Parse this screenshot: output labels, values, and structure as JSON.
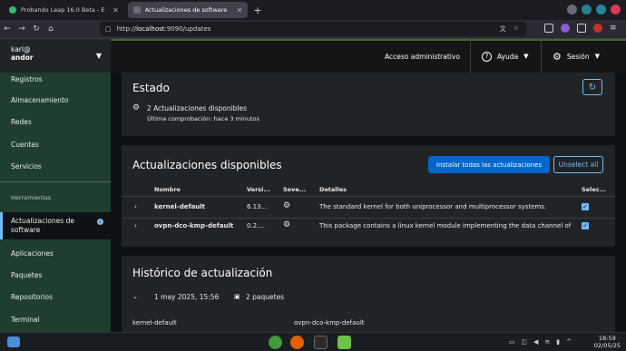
{
  "browser": {
    "tabs": [
      {
        "title": "Probando Leap 16.0 Beta - E",
        "active": false
      },
      {
        "title": "Actualizaciones de software",
        "active": true
      }
    ],
    "url_prefix": "http://",
    "url_host": "localhost",
    "url_rest": ":9090/updates"
  },
  "header": {
    "user": "karl@",
    "host": "andor",
    "admin_access": "Acceso administrativo",
    "help": "Ayuda",
    "session": "Sesión"
  },
  "sidebar": {
    "items_top": [
      "Registros",
      "Almacenamiento",
      "Redes",
      "Cuentas",
      "Servicios"
    ],
    "section": "Herramientas",
    "items_tools": [
      "Actualizaciones de software",
      "Aplicaciones",
      "Paquetes",
      "Repositorios",
      "Terminal"
    ]
  },
  "status_card": {
    "title": "Estado",
    "message": "2 Actualizaciones disponibles",
    "last_check": "Última comprobación: hace 3 minutos"
  },
  "updates_card": {
    "title": "Actualizaciones disponibles",
    "install_all": "Instalar todas las actualizaciones",
    "unselect_all": "Unselect all",
    "columns": [
      "Nombre",
      "Versi...",
      "Seve...",
      "Detalles",
      "Selec..."
    ],
    "rows": [
      {
        "name": "kernel-default",
        "version": "6.13...",
        "details": "The standard kernel for both uniprocessor and multiprocessor systems.",
        "selected": true
      },
      {
        "name": "ovpn-dco-kmp-default",
        "version": "0.2....",
        "details": "This package contains a linux kernel module implementing the data channel of",
        "selected": true
      }
    ]
  },
  "history_card": {
    "title": "Histórico de actualización",
    "date": "1 may 2025, 15:56",
    "packages": "2 paquetes",
    "package_list": [
      "kernel-default",
      "ovpn-dco-kmp-default"
    ]
  },
  "taskbar": {
    "time": "18:59",
    "date": "02/05/25"
  }
}
